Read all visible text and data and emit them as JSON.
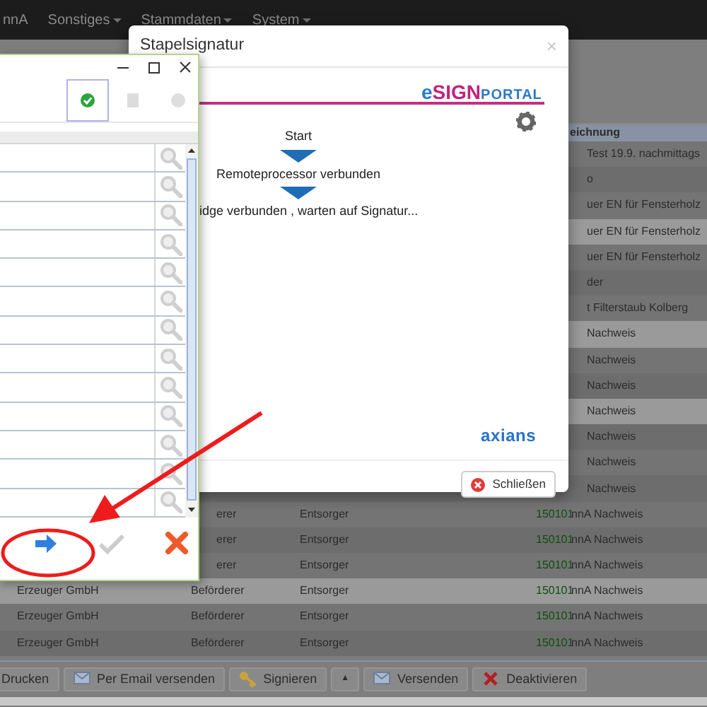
{
  "navbar": {
    "items": [
      {
        "label": "nnA",
        "dropdown": false
      },
      {
        "label": "Sonstiges",
        "dropdown": true
      },
      {
        "label": "Stammdaten",
        "dropdown": true
      },
      {
        "label": "System",
        "dropdown": true
      }
    ]
  },
  "table": {
    "header": "eichnung",
    "rows": [
      {
        "kind": "covered",
        "highlighted": false,
        "column_5": "Test 19.9. nachmittags"
      },
      {
        "kind": "covered",
        "highlighted": false,
        "column_5": "o"
      },
      {
        "kind": "covered",
        "highlighted": false,
        "column_5": "uer EN für Fensterholz"
      },
      {
        "kind": "covered",
        "highlighted": true,
        "column_5": "uer EN für Fensterholz"
      },
      {
        "kind": "covered",
        "highlighted": false,
        "column_5": "uer EN für Fensterholz"
      },
      {
        "kind": "covered",
        "highlighted": false,
        "column_5": "der"
      },
      {
        "kind": "covered",
        "highlighted": false,
        "column_5": "t Filterstaub Kolberg"
      },
      {
        "kind": "covered",
        "highlighted": true,
        "column_5": "Nachweis"
      },
      {
        "kind": "covered",
        "highlighted": false,
        "column_5": "Nachweis"
      },
      {
        "kind": "covered",
        "highlighted": false,
        "column_5": "Nachweis"
      },
      {
        "kind": "covered",
        "highlighted": true,
        "column_5": "Nachweis"
      },
      {
        "kind": "covered",
        "highlighted": false,
        "column_5": "Nachweis"
      },
      {
        "kind": "covered",
        "highlighted": false,
        "column_5": "Nachweis"
      },
      {
        "kind": "covered",
        "highlighted": false,
        "column_5": "Nachweis"
      },
      {
        "kind": "partial",
        "highlighted": false,
        "column_2": "erer",
        "column_3": "Entsorger",
        "column_4": "150101",
        "column_5": "nnA Nachweis"
      },
      {
        "kind": "partial",
        "highlighted": false,
        "column_2": "erer",
        "column_3": "Entsorger",
        "column_4": "150101",
        "column_5": "nnA Nachweis"
      },
      {
        "kind": "partial",
        "highlighted": false,
        "column_2": "erer",
        "column_3": "Entsorger",
        "column_4": "150101",
        "column_5": "nnA Nachweis"
      },
      {
        "kind": "full",
        "highlighted": true,
        "column_1": "Erzeuger GmbH",
        "column_2": "Beförderer",
        "column_3": "Entsorger",
        "column_4": "150101",
        "column_5": "nnA Nachweis"
      },
      {
        "kind": "full",
        "highlighted": false,
        "column_1": "Erzeuger GmbH",
        "column_2": "Beförderer",
        "column_3": "Entsorger",
        "column_4": "150101",
        "column_5": "nnA Nachweis"
      },
      {
        "kind": "full",
        "highlighted": false,
        "column_1": "Erzeuger GmbH",
        "column_2": "Beförderer",
        "column_3": "Entsorger",
        "column_4": "150101",
        "column_5": "nnA Nachweis"
      }
    ]
  },
  "toolbar": [
    {
      "kind": "plain",
      "label": "Drucken"
    },
    {
      "kind": "mail",
      "label": "Per Email versenden"
    },
    {
      "kind": "key",
      "label": "Signieren"
    },
    {
      "kind": "caret",
      "label": "▲"
    },
    {
      "kind": "mail",
      "label": "Versenden"
    },
    {
      "kind": "cross",
      "label": "Deaktivieren"
    }
  ],
  "modal": {
    "title": "Stapelsignatur",
    "close": "×",
    "brand": {
      "part_1": "eSIGN",
      "part_2": "PORTAL"
    },
    "steps": [
      "Start",
      "Remoteprocessor verbunden",
      "idge verbunden , warten auf Signatur..."
    ],
    "footer_brand": "axians",
    "button": "Schließen"
  },
  "signer_window": {
    "tools": [
      {
        "kind": "check",
        "selected": true
      },
      {
        "kind": "document",
        "selected": false
      },
      {
        "kind": "dot",
        "selected": false
      }
    ],
    "rows": [
      {
        "kind": "lookup"
      },
      {
        "kind": "lookup"
      },
      {
        "kind": "lookup"
      },
      {
        "kind": "lookup"
      },
      {
        "kind": "lookup"
      },
      {
        "kind": "lookup"
      },
      {
        "kind": "lookup"
      },
      {
        "kind": "lookup"
      },
      {
        "kind": "lookup"
      },
      {
        "kind": "lookup"
      },
      {
        "kind": "lookup"
      },
      {
        "kind": "lookup"
      },
      {
        "kind": "lookup"
      }
    ],
    "actions": [
      {
        "kind": "next",
        "disabled": false
      },
      {
        "kind": "confirm",
        "disabled": true
      },
      {
        "kind": "cancel",
        "disabled": false
      }
    ]
  }
}
